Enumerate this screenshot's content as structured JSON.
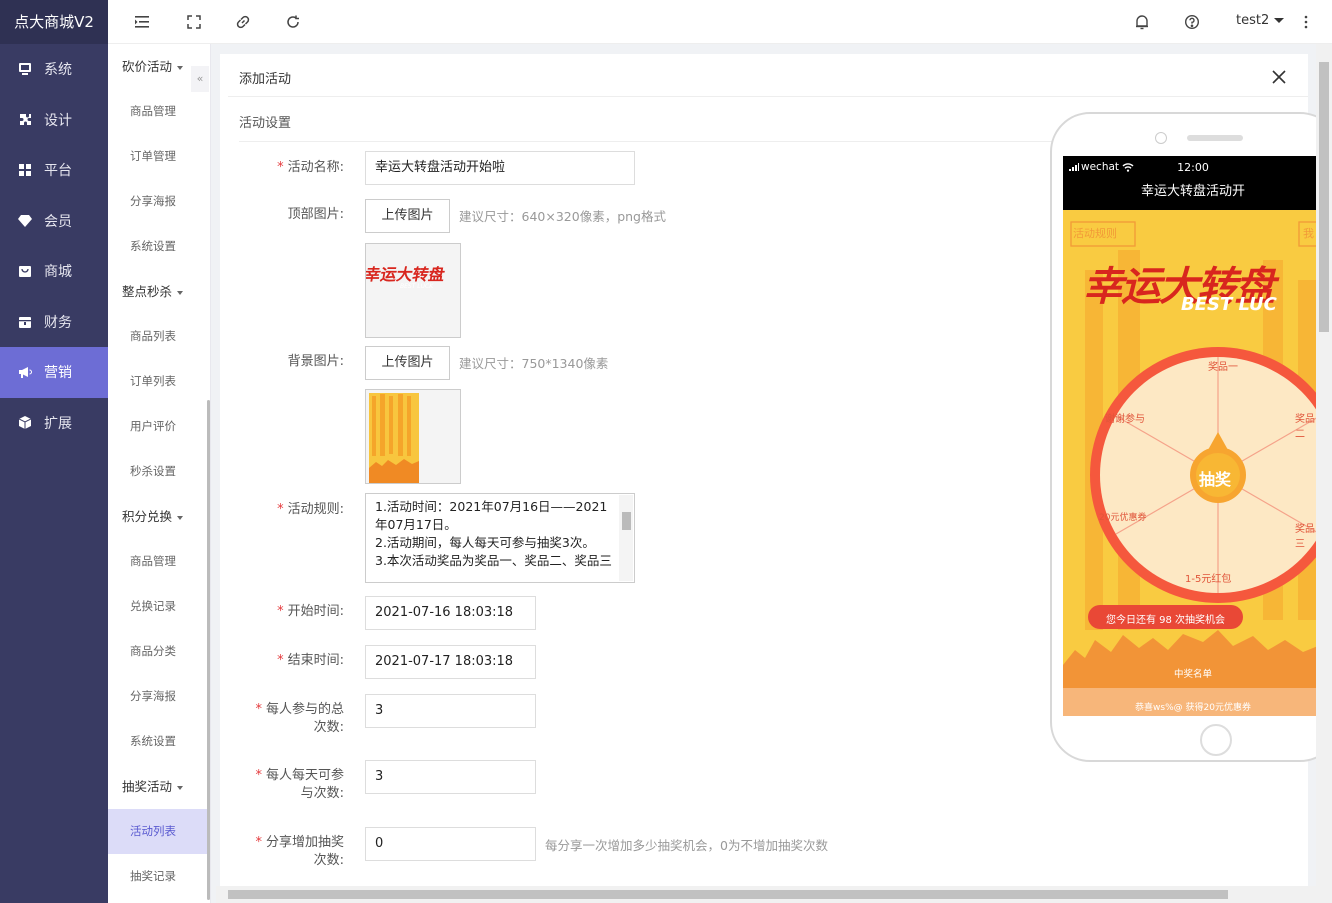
{
  "app": {
    "title": "点大商城V2"
  },
  "main_nav": [
    {
      "label": "系统",
      "icon": "monitor-icon"
    },
    {
      "label": "设计",
      "icon": "puzzle-icon"
    },
    {
      "label": "平台",
      "icon": "grid-icon"
    },
    {
      "label": "会员",
      "icon": "diamond-icon"
    },
    {
      "label": "商城",
      "icon": "shop-icon"
    },
    {
      "label": "财务",
      "icon": "wallet-icon"
    },
    {
      "label": "营销",
      "icon": "megaphone-icon",
      "active": true
    },
    {
      "label": "扩展",
      "icon": "cube-icon"
    }
  ],
  "sub_nav": {
    "group1": {
      "label": "砍价活动",
      "items": [
        "商品管理",
        "订单管理",
        "分享海报",
        "系统设置"
      ]
    },
    "group2": {
      "label": "整点秒杀",
      "items": [
        "商品列表",
        "订单列表",
        "用户评价",
        "秒杀设置"
      ]
    },
    "group3": {
      "label": "积分兑换",
      "items": [
        "商品管理",
        "兑换记录",
        "商品分类",
        "分享海报",
        "系统设置"
      ]
    },
    "group4": {
      "label": "抽奖活动",
      "items": [
        "活动列表",
        "抽奖记录"
      ]
    }
  },
  "topbar": {
    "user": "test2"
  },
  "panel": {
    "title": "添加活动",
    "section": "活动设置"
  },
  "form": {
    "name_label": "活动名称:",
    "name_value": "幸运大转盘活动开始啦",
    "top_img_label": "顶部图片:",
    "upload_label": "上传图片",
    "top_img_hint": "建议尺寸：640×320像素，png格式",
    "bg_img_label": "背景图片:",
    "bg_img_hint": "建议尺寸：750*1340像素",
    "rules_label": "活动规则:",
    "rules_value": "1.活动时间：2021年07月16日——2021年07月17日。\n2.活动期间，每人每天可参与抽奖3次。\n3.本次活动奖品为奖品一、奖品二、奖品三",
    "start_label": "开始时间:",
    "start_value": "2021-07-16 18:03:18",
    "end_label": "结束时间:",
    "end_value": "2021-07-17 18:03:18",
    "total_label_1": "每人参与的总",
    "total_label_2": "次数:",
    "total_value": "3",
    "daily_label_1": "每人每天可参",
    "daily_label_2": "与次数:",
    "daily_value": "3",
    "share_label_1": "分享增加抽奖",
    "share_label_2": "次数:",
    "share_value": "0",
    "share_hint": "每分享一次增加多少抽奖机会，0为不增加抽奖次数"
  },
  "phone": {
    "carrier": "wechat",
    "time": "12:00",
    "title": "幸运大转盘活动开",
    "rules_btn": "活动规则",
    "mine_btn": "我",
    "banner": "幸运大转盘",
    "banner_en": "BEST LUC",
    "spin_btn": "抽奖",
    "prizes": [
      "奖品一",
      "奖品二",
      "奖品三",
      "1-5元红包",
      "20元优惠券",
      "谢谢参与"
    ],
    "chances": "您今日还有 98 次抽奖机会",
    "winners_title": "中奖名单",
    "winner_line": "恭喜ws%@ 获得20元优惠券"
  },
  "colors": {
    "sidebar": "#393b63",
    "accent": "#6d6dd5",
    "required": "#e4393c"
  }
}
